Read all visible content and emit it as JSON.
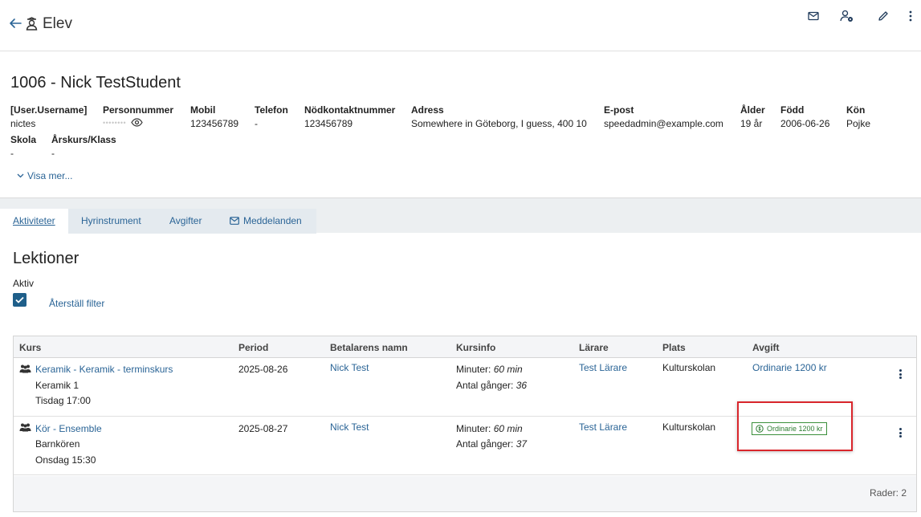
{
  "header": {
    "title": "Elev",
    "icons": [
      "back-arrow-icon",
      "student-icon",
      "mail-icon",
      "user-settings-icon",
      "edit-pencil-icon",
      "more-vertical-icon"
    ]
  },
  "student": {
    "heading": "1006 - Nick TestStudent",
    "fields": {
      "username": {
        "label": "[User.Username]",
        "value": "nictes"
      },
      "personnummer": {
        "label": "Personnummer",
        "value": "••••••••"
      },
      "mobil": {
        "label": "Mobil",
        "value": "123456789"
      },
      "telefon": {
        "label": "Telefon",
        "value": "-"
      },
      "nodkontakt": {
        "label": "Nödkontaktnummer",
        "value": "123456789"
      },
      "adress": {
        "label": "Adress",
        "value": "Somewhere in Göteborg, I guess, 400 10"
      },
      "epost": {
        "label": "E-post",
        "value": "speedadmin@example.com"
      },
      "alder": {
        "label": "Ålder",
        "value": "19 år"
      },
      "fodd": {
        "label": "Född",
        "value": "2006-06-26"
      },
      "kon": {
        "label": "Kön",
        "value": "Pojke"
      },
      "skola": {
        "label": "Skola",
        "value": "-"
      },
      "arskurs": {
        "label": "Årskurs/Klass",
        "value": "-"
      }
    },
    "show_more": "Visa mer..."
  },
  "tabs": [
    {
      "label": "Aktiviteter",
      "active": true
    },
    {
      "label": "Hyrinstrument",
      "active": false
    },
    {
      "label": "Avgifter",
      "active": false
    },
    {
      "label": "Meddelanden",
      "active": false
    }
  ],
  "lessons": {
    "title": "Lektioner",
    "filter_label": "Aktiv",
    "filter_checked": true,
    "reset_filter": "Återställ filter",
    "columns": [
      "Kurs",
      "Period",
      "Betalarens namn",
      "Kursinfo",
      "Lärare",
      "Plats",
      "Avgift"
    ],
    "rows": [
      {
        "course": "Keramik - Keramik - terminskurs",
        "course_sub1": "Keramik 1",
        "course_sub2": "Tisdag 17:00",
        "period": "2025-08-26",
        "payer": "Nick Test",
        "minutes_label": "Minuter:",
        "minutes_value": "60 min",
        "times_label": "Antal gånger:",
        "times_value": "36",
        "teacher": "Test Lärare",
        "location": "Kulturskolan",
        "fee": "Ordinarie 1200 kr"
      },
      {
        "course": "Kör - Ensemble",
        "course_sub1": "Barnkören",
        "course_sub2": "Onsdag 15:30",
        "period": "2025-08-27",
        "payer": "Nick Test",
        "minutes_label": "Minuter:",
        "minutes_value": "60 min",
        "times_label": "Antal gånger:",
        "times_value": "37",
        "teacher": "Test Lärare",
        "location": "Kulturskolan",
        "fee": "Ordinarie 1200 kr"
      }
    ],
    "row_count": "Rader: 2"
  },
  "colors": {
    "link": "#2a6496",
    "checkbox": "#1f5f8a",
    "badge_green": "#2e7d32",
    "highlight_red": "#d9262c"
  }
}
